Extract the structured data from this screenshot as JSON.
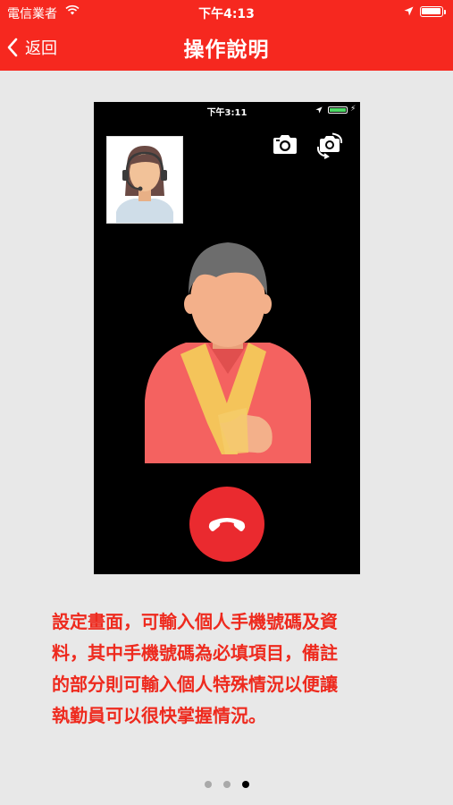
{
  "status_bar": {
    "carrier": "電信業者",
    "time": "下午4:13"
  },
  "nav": {
    "back_label": "返回",
    "title": "操作說明"
  },
  "phone_preview": {
    "status_time": "下午3:11",
    "battery_color": "#4cd964",
    "icons": [
      "camera-icon",
      "switch-camera-icon",
      "hang-up-icon"
    ]
  },
  "description": "設定畫面，可輸入個人手機號碼及資\n料，其中手機號碼為必填項目，備註\n的部分則可輸入個人特殊情況以便讓\n執勤員可以很快掌握情況。",
  "pagination": {
    "pages": 3,
    "current": 3
  },
  "colors": {
    "accent": "#f6281f",
    "text_accent": "#ee2a1e",
    "hangup": "#ea2a2f",
    "background": "#e8e8e8"
  }
}
